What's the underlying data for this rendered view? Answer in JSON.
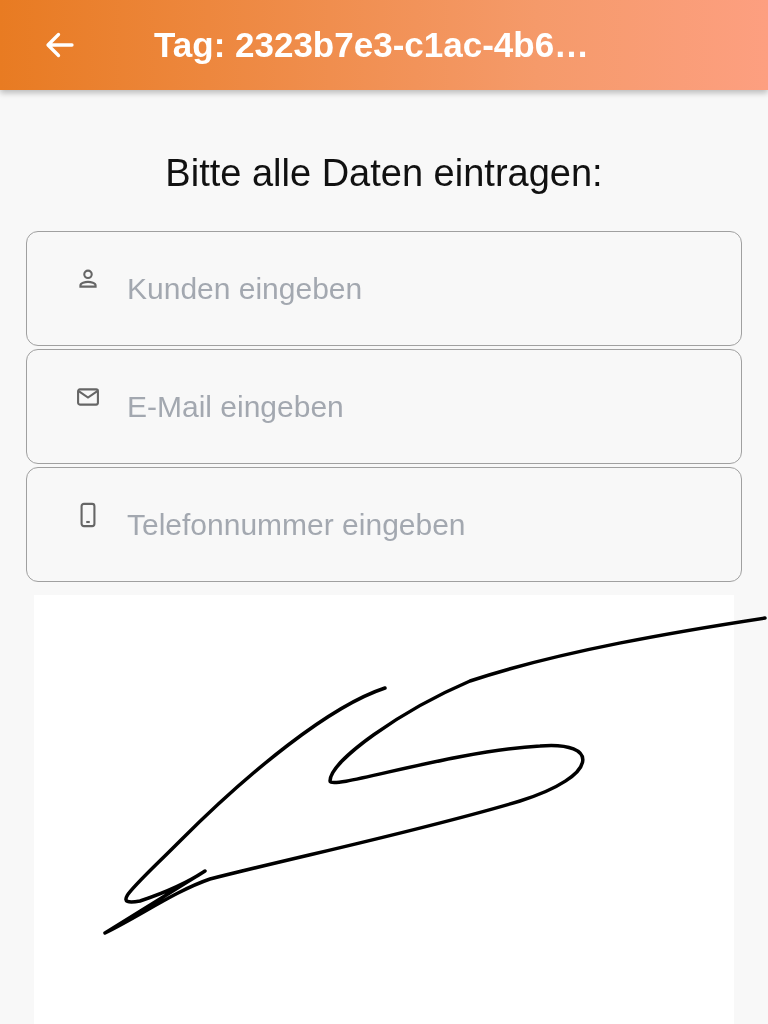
{
  "app_bar": {
    "title": "Tag: 2323b7e3-c1ac-4b6…"
  },
  "heading": "Bitte alle Daten eintragen:",
  "fields": [
    {
      "kind": "person",
      "placeholder": "Kunden eingeben"
    },
    {
      "kind": "mail",
      "placeholder": "E-Mail eingeben"
    },
    {
      "kind": "phone",
      "placeholder": "Telefonnummer eingeben"
    }
  ]
}
